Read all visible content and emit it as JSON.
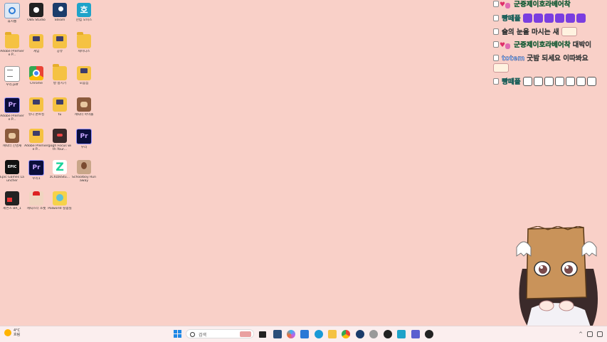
{
  "desktop": {
    "icons": [
      {
        "label": "휴지통"
      },
      {
        "label": "OBS Studio"
      },
      {
        "label": "Steam"
      },
      {
        "label": "한컴 오피스"
      },
      {
        "label": "Adobe Premiere P..."
      },
      {
        "label": "게임"
      },
      {
        "label": "공유"
      },
      {
        "label": "제이디스"
      },
      {
        "label": "우리.pdf"
      },
      {
        "label": "Chrome"
      },
      {
        "label": "방 송시기"
      },
      {
        "label": "모음집"
      },
      {
        "label": "Adobe Premiere P..."
      },
      {
        "label": "유니 폰트킹"
      },
      {
        "label": "tu"
      },
      {
        "label": "캐릭터 아이돌"
      },
      {
        "label": "캐릭터 진영재"
      },
      {
        "label": "Adobe Premiere P..."
      },
      {
        "label": "gogh Focus with Your..."
      },
      {
        "label": "우리"
      },
      {
        "label": "Epic Games Launcher"
      },
      {
        "label": "우리1"
      },
      {
        "label": "zChzzkStu..."
      },
      {
        "label": "Schoolboy Runaway"
      },
      {
        "label": "세컨즈 BR_1"
      },
      {
        "label": "캐릭스터 소켓"
      },
      {
        "label": "Palworld 실험실"
      }
    ]
  },
  "chat": {
    "messages": [
      {
        "name": "군중제이호라베어착",
        "text": ""
      },
      {
        "name": "빵떼플",
        "text": ""
      },
      {
        "name": "",
        "text": "술의 눈을 마시는 새"
      },
      {
        "name": "군중제이호라베어착",
        "text": "대박이"
      },
      {
        "name": "totem",
        "text": "굿밤 되세요 이따봐요"
      },
      {
        "name": "빵떼플",
        "text": ""
      }
    ]
  },
  "taskbar": {
    "weather_temp": "4°C",
    "weather_desc": "흐림",
    "search_placeholder": "검색"
  }
}
